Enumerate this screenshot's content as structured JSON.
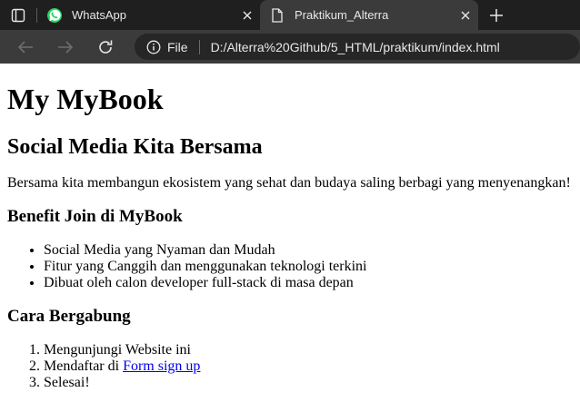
{
  "browser": {
    "tabs": [
      {
        "title": "WhatsApp",
        "favicon": "whatsapp-icon",
        "active": false
      },
      {
        "title": "Praktikum_Alterra",
        "favicon": "document-icon",
        "active": true
      }
    ],
    "address": {
      "scheme_label": "File",
      "url": "D:/Alterra%20Github/5_HTML/praktikum/index.html"
    },
    "colors": {
      "tabbar": "#1f1f1f",
      "toolbar": "#3b3b3b",
      "omnibox": "#262626",
      "whatsapp": "#25d366",
      "link": "#0000ee"
    }
  },
  "page": {
    "title": "My MyBook",
    "subtitle": "Social Media Kita Bersama",
    "intro": "Bersama kita membangun ekosistem yang sehat dan budaya saling berbagi yang menyenangkan!",
    "benefits": {
      "heading": "Benefit Join di MyBook",
      "items": [
        "Social Media yang Nyaman dan Mudah",
        "Fitur yang Canggih dan menggunakan teknologi terkini",
        "Dibuat oleh calon developer full-stack di masa depan"
      ]
    },
    "join": {
      "heading": "Cara Bergabung",
      "step1": "Mengunjungi Website ini",
      "step2_prefix": "Mendaftar di ",
      "step2_link": "Form sign up",
      "step3": "Selesai!"
    }
  }
}
